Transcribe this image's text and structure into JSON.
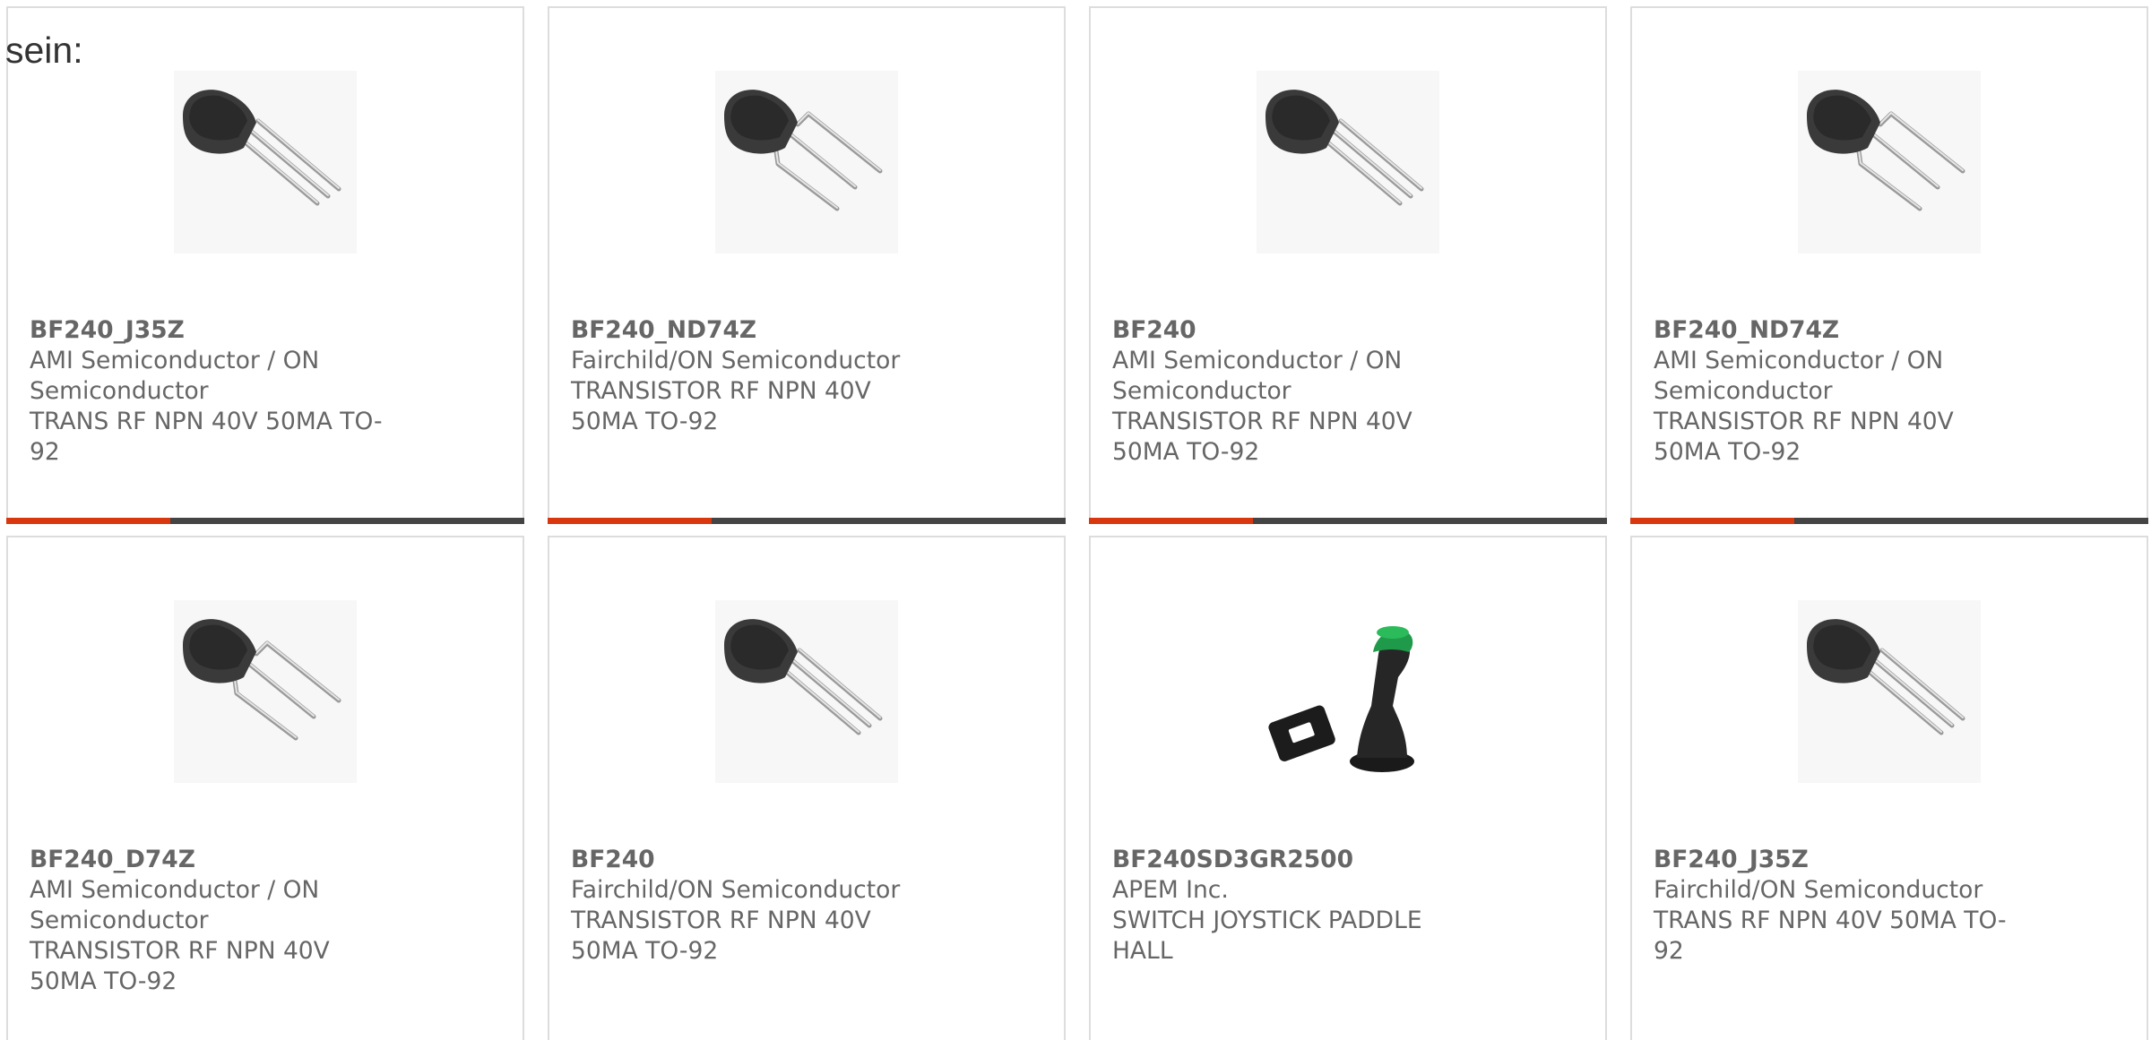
{
  "intro_text": "sein:",
  "colors": {
    "accent": "#d9380f",
    "bar": "#444444",
    "border": "#dddddd",
    "text": "#666666"
  },
  "products": [
    {
      "part_number": "BF240_J35Z",
      "manufacturer": "AMI Semiconductor / ON Semiconductor",
      "description": "TRANS RF NPN 40V 50MA TO-92",
      "image": "to92-transistor-straight-leads"
    },
    {
      "part_number": "BF240_ND74Z",
      "manufacturer": "Fairchild/ON Semiconductor",
      "description": "TRANSISTOR RF NPN 40V 50MA TO-92",
      "image": "to92-transistor-bent-leads"
    },
    {
      "part_number": "BF240",
      "manufacturer": "AMI Semiconductor / ON Semiconductor",
      "description": "TRANSISTOR RF NPN 40V 50MA TO-92",
      "image": "to92-transistor-straight-leads"
    },
    {
      "part_number": "BF240_ND74Z",
      "manufacturer": "AMI Semiconductor / ON Semiconductor",
      "description": "TRANSISTOR RF NPN 40V 50MA TO-92",
      "image": "to92-transistor-bent-leads"
    },
    {
      "part_number": "BF240_D74Z",
      "manufacturer": "AMI Semiconductor / ON Semiconductor",
      "description": "TRANSISTOR RF NPN 40V 50MA TO-92",
      "image": "to92-transistor-bent-leads"
    },
    {
      "part_number": "BF240",
      "manufacturer": "Fairchild/ON Semiconductor",
      "description": "TRANSISTOR RF NPN 40V 50MA TO-92",
      "image": "to92-transistor-straight-leads"
    },
    {
      "part_number": "BF240SD3GR2500",
      "manufacturer": "APEM Inc.",
      "description": "SWITCH JOYSTICK PADDLE HALL",
      "image": "joystick-paddle"
    },
    {
      "part_number": "BF240_J35Z",
      "manufacturer": "Fairchild/ON Semiconductor",
      "description": "TRANS RF NPN 40V 50MA TO-92",
      "image": "to92-transistor-straight-leads"
    }
  ]
}
